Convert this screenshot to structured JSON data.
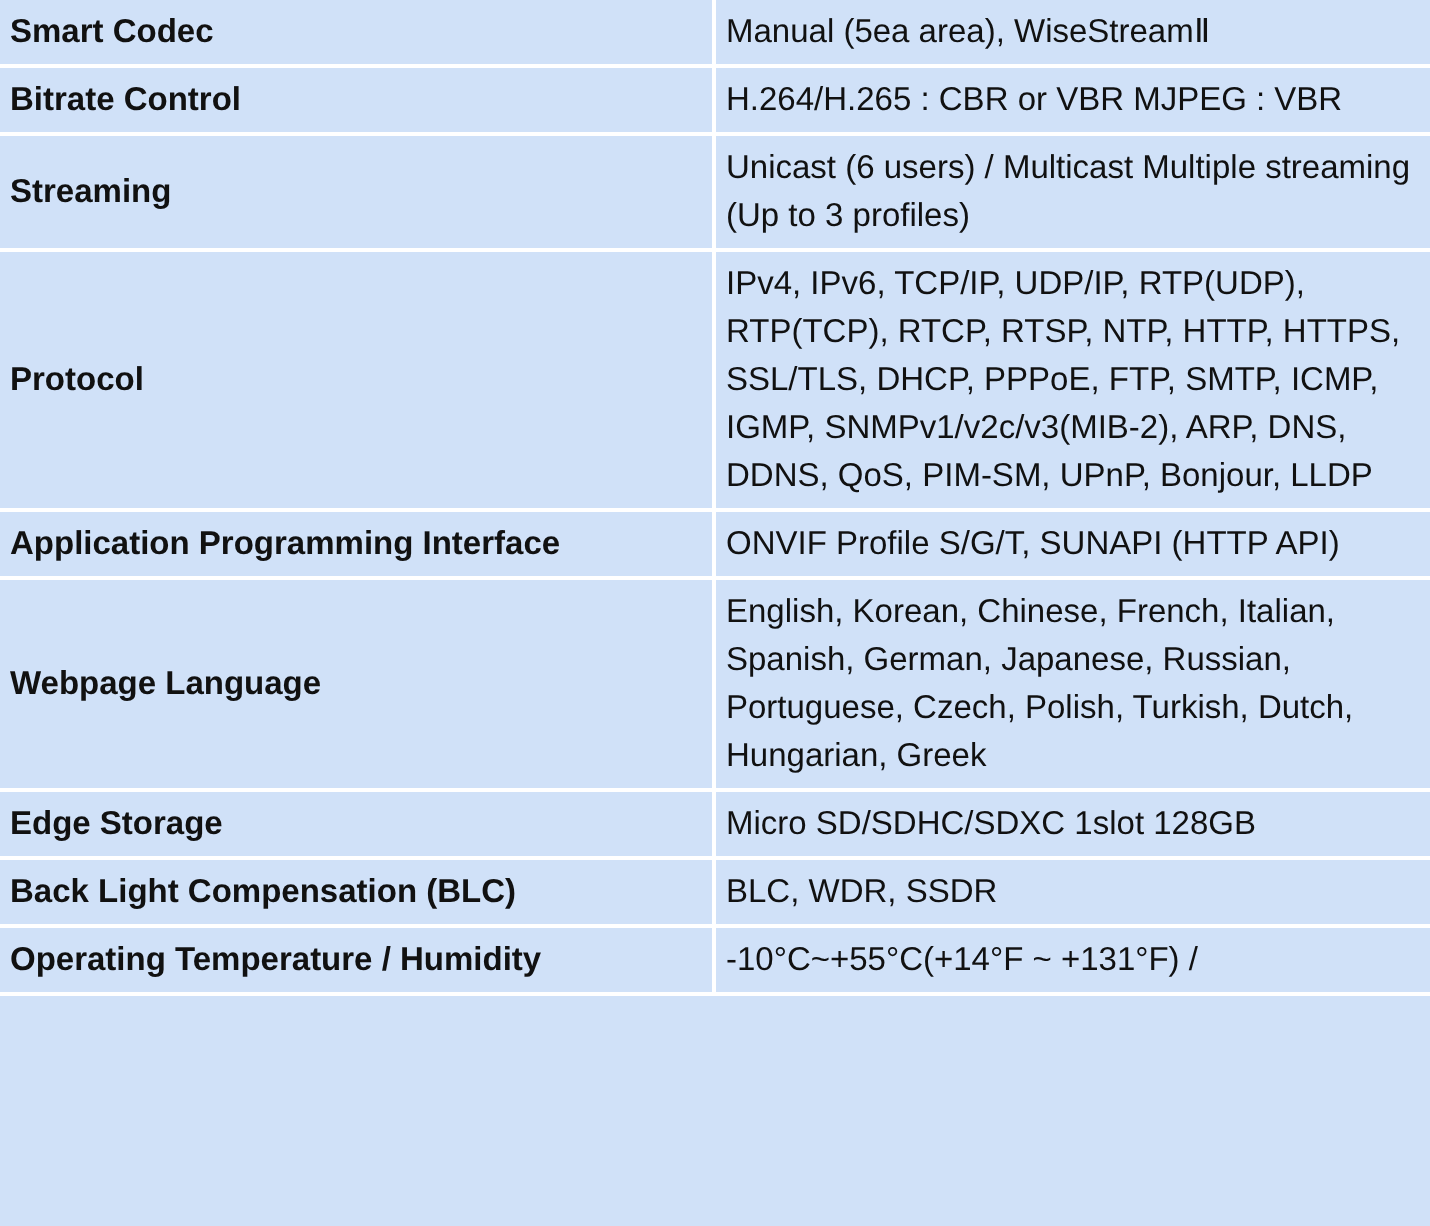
{
  "rows": [
    {
      "label": "Smart Codec",
      "value": "Manual (5ea area), WiseStreamⅡ"
    },
    {
      "label": "Bitrate Control",
      "value": "H.264/H.265 : CBR or VBR MJPEG : VBR"
    },
    {
      "label": "Streaming",
      "value": "Unicast (6 users) / Multicast Multiple streaming (Up to 3 profiles)"
    },
    {
      "label": "Protocol",
      "value": "IPv4, IPv6, TCP/IP, UDP/IP, RTP(UDP), RTP(TCP), RTCP, RTSP, NTP, HTTP, HTTPS, SSL/TLS, DHCP, PPPoE, FTP, SMTP, ICMP, IGMP, SNMPv1/v2c/v3(MIB-2), ARP, DNS, DDNS, QoS, PIM-SM, UPnP, Bonjour, LLDP"
    },
    {
      "label": "Application Programming Interface",
      "value": "ONVIF Profile S/G/T, SUNAPI (HTTP API)"
    },
    {
      "label": "Webpage Language",
      "value": "English, Korean, Chinese, French, Italian, Spanish, German, Japanese, Russian, Portuguese, Czech, Polish, Turkish, Dutch, Hungarian, Greek"
    },
    {
      "label": "Edge Storage",
      "value": "Micro SD/SDHC/SDXC 1slot 128GB"
    },
    {
      "label": "Back Light Compensation (BLC)",
      "value": "BLC, WDR, SSDR"
    },
    {
      "label": "Operating Temperature / Humidity",
      "value": "-10°C~+55°C(+14°F ~ +131°F) /"
    }
  ]
}
